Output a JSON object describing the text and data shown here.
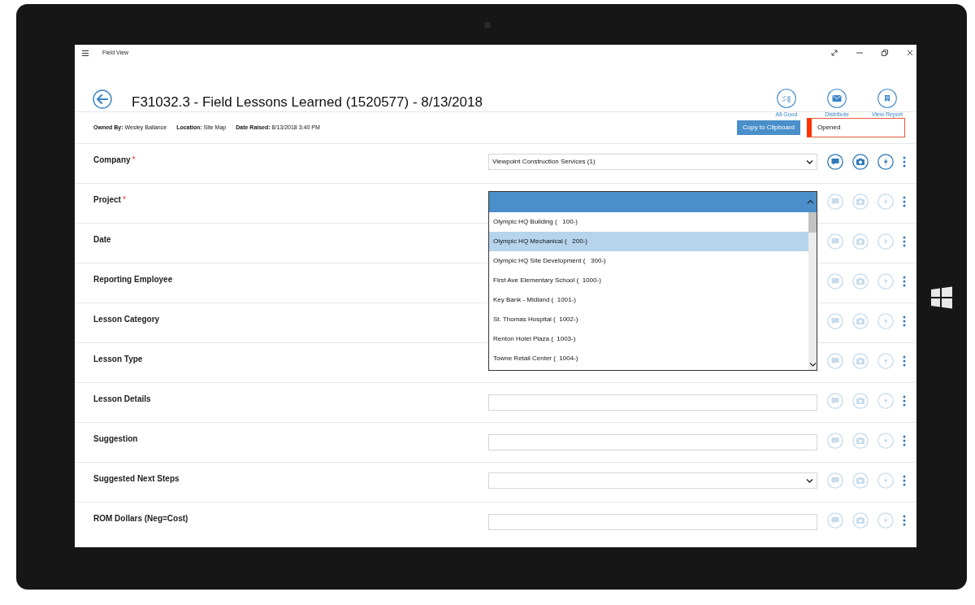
{
  "window": {
    "title": "Field View"
  },
  "header": {
    "title": "F31032.3 - Field Lessons Learned (1520577) - 8/13/2018",
    "actions": [
      {
        "label": "All Good",
        "kind": "checklist"
      },
      {
        "label": "Distribute",
        "kind": "mail"
      },
      {
        "label": "View Report",
        "kind": "report"
      }
    ]
  },
  "meta": [
    {
      "label": "Owned By:",
      "value": "Wesley Ballance"
    },
    {
      "label": "Location:",
      "value": "Site Map"
    },
    {
      "label": "Date Raised:",
      "value": "8/13/2018 3:40 PM"
    }
  ],
  "copy_button": "Copy to Clipboard",
  "status": "Opened",
  "fields": [
    {
      "label": "Company",
      "required_mark": "*",
      "kind": "select",
      "value": "Viewpoint Construction Services (1)",
      "actions_enabled": true
    },
    {
      "label": "Project",
      "required_mark": "*",
      "kind": "dropdown",
      "expanded": true,
      "actions_enabled": false,
      "options": [
        {
          "label": "Olympic HQ Building (   100-)",
          "selected": false
        },
        {
          "label": "Olympic HQ Mechanical (   200-)",
          "selected": true
        },
        {
          "label": "Olympic HQ Site Development (   300-)",
          "selected": false
        },
        {
          "label": "First Ave Elementary School (  1000-)",
          "selected": false
        },
        {
          "label": "Key Bank - Midland (  1001-)",
          "selected": false
        },
        {
          "label": "St. Thomas Hospital (  1002-)",
          "selected": false
        },
        {
          "label": "Renton Hotel Plaza (  1003-)",
          "selected": false
        },
        {
          "label": "Towne Retail Center (  1004-)",
          "selected": false
        }
      ]
    },
    {
      "label": "Date",
      "kind": "covered",
      "actions_enabled": false
    },
    {
      "label": "Reporting Employee",
      "kind": "covered",
      "actions_enabled": false
    },
    {
      "label": "Lesson Category",
      "kind": "covered",
      "actions_enabled": false
    },
    {
      "label": "Lesson Type",
      "kind": "covered",
      "actions_enabled": false
    },
    {
      "label": "Lesson Details",
      "kind": "text",
      "actions_enabled": false
    },
    {
      "label": "Suggestion",
      "kind": "text",
      "actions_enabled": false
    },
    {
      "label": "Suggested Next Steps",
      "kind": "select",
      "actions_enabled": false
    },
    {
      "label": "ROM Dollars (Neg=Cost)",
      "kind": "text",
      "actions_enabled": false
    }
  ]
}
